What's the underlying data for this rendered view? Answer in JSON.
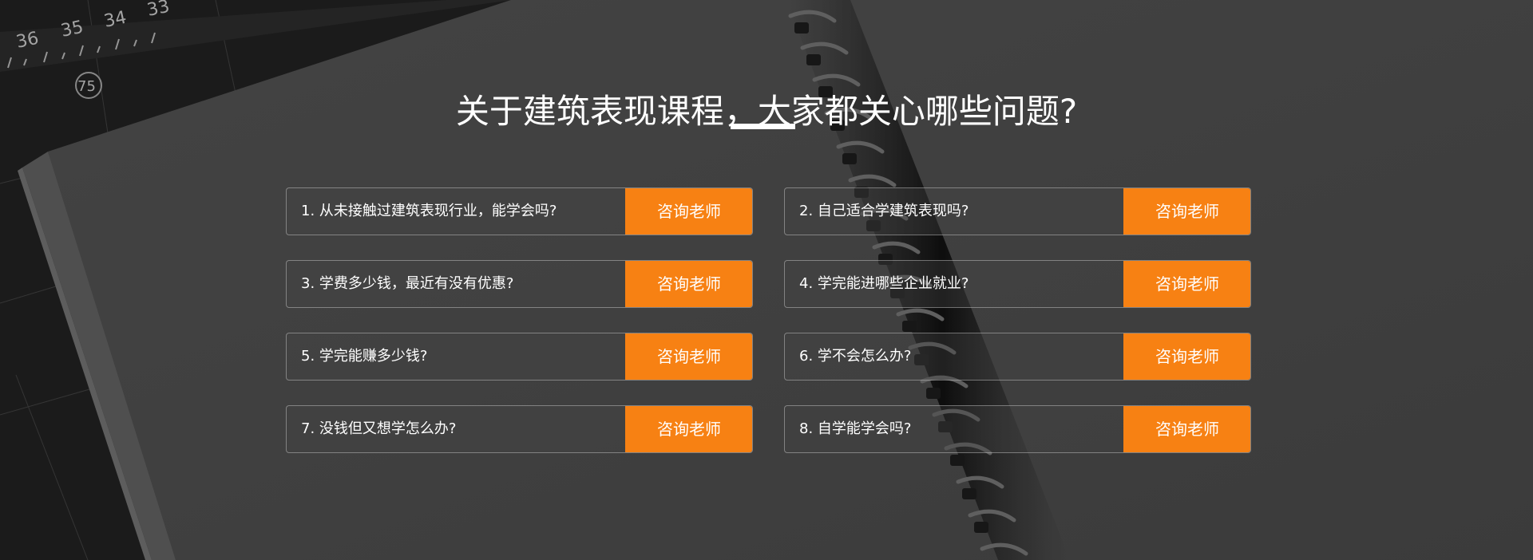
{
  "section": {
    "title": "关于建筑表现课程，大家都关心哪些问题?"
  },
  "faq": {
    "items": [
      {
        "question": "1. 从未接触过建筑表现行业，能学会吗?",
        "button_label": "咨询老师"
      },
      {
        "question": "2. 自己适合学建筑表现吗?",
        "button_label": "咨询老师"
      },
      {
        "question": "3. 学费多少钱，最近有没有优惠?",
        "button_label": "咨询老师"
      },
      {
        "question": "4. 学完能进哪些企业就业?",
        "button_label": "咨询老师"
      },
      {
        "question": "5. 学完能赚多少钱?",
        "button_label": "咨询老师"
      },
      {
        "question": "6. 学不会怎么办?",
        "button_label": "咨询老师"
      },
      {
        "question": "7. 没钱但又想学怎么办?",
        "button_label": "咨询老师"
      },
      {
        "question": "8. 自学能学会吗?",
        "button_label": "咨询老师"
      }
    ]
  },
  "background": {
    "ruler_marks": [
      "36",
      "35",
      "34",
      "33"
    ],
    "mat_label": "75"
  },
  "colors": {
    "accent": "#f78113",
    "text": "#ffffff",
    "background": "#484848"
  }
}
